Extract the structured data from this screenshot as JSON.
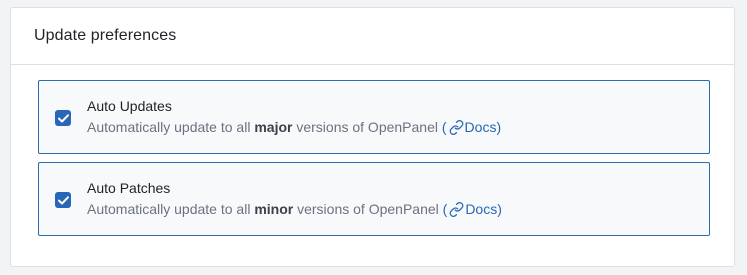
{
  "card": {
    "title": "Update preferences"
  },
  "options": [
    {
      "label": "Auto Updates",
      "checked": true,
      "desc_prefix": "Automatically update to all ",
      "desc_strong": "major",
      "desc_suffix": " versions of OpenPanel ",
      "link_open": "(",
      "link_label": "Docs)"
    },
    {
      "label": "Auto Patches",
      "checked": true,
      "desc_prefix": "Automatically update to all ",
      "desc_strong": "minor",
      "desc_suffix": " versions of OpenPanel ",
      "link_open": "(",
      "link_label": "Docs)"
    }
  ],
  "colors": {
    "accent": "#2866b8",
    "border": "#dde1e6",
    "option_border": "#2b6cb0"
  },
  "icons": {
    "checkbox": "check-icon",
    "link": "link-icon"
  }
}
